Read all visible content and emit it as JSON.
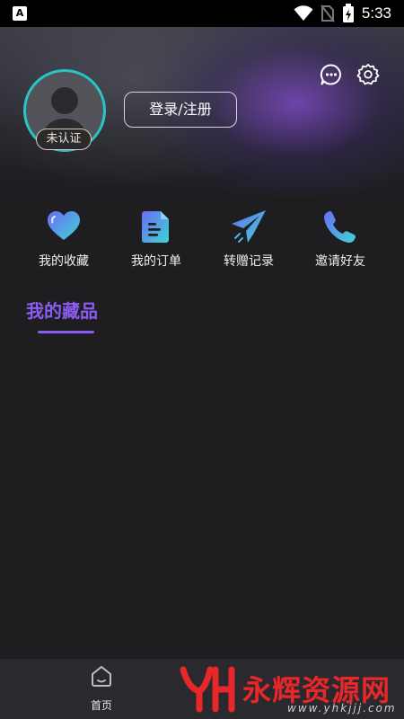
{
  "status_bar": {
    "time": "5:33",
    "app_icon_letter": "A"
  },
  "profile": {
    "verification_badge": "未认证",
    "login_button": "登录/注册"
  },
  "quick_actions": [
    {
      "label": "我的收藏",
      "icon": "heart-icon"
    },
    {
      "label": "我的订单",
      "icon": "document-icon"
    },
    {
      "label": "转赠记录",
      "icon": "paper-plane-icon"
    },
    {
      "label": "邀请好友",
      "icon": "phone-icon"
    }
  ],
  "section": {
    "title": "我的藏品"
  },
  "bottom_nav": {
    "home_label": "首页"
  },
  "watermark": {
    "text": "永辉资源网",
    "url": "www.yhkjjj.com"
  },
  "colors": {
    "accent": "#8a5cf0",
    "avatar_ring": "#29c4c6",
    "icon_gradient_start": "#6a6cf5",
    "icon_gradient_end": "#3fd4d4",
    "watermark_red": "#e8272a"
  }
}
